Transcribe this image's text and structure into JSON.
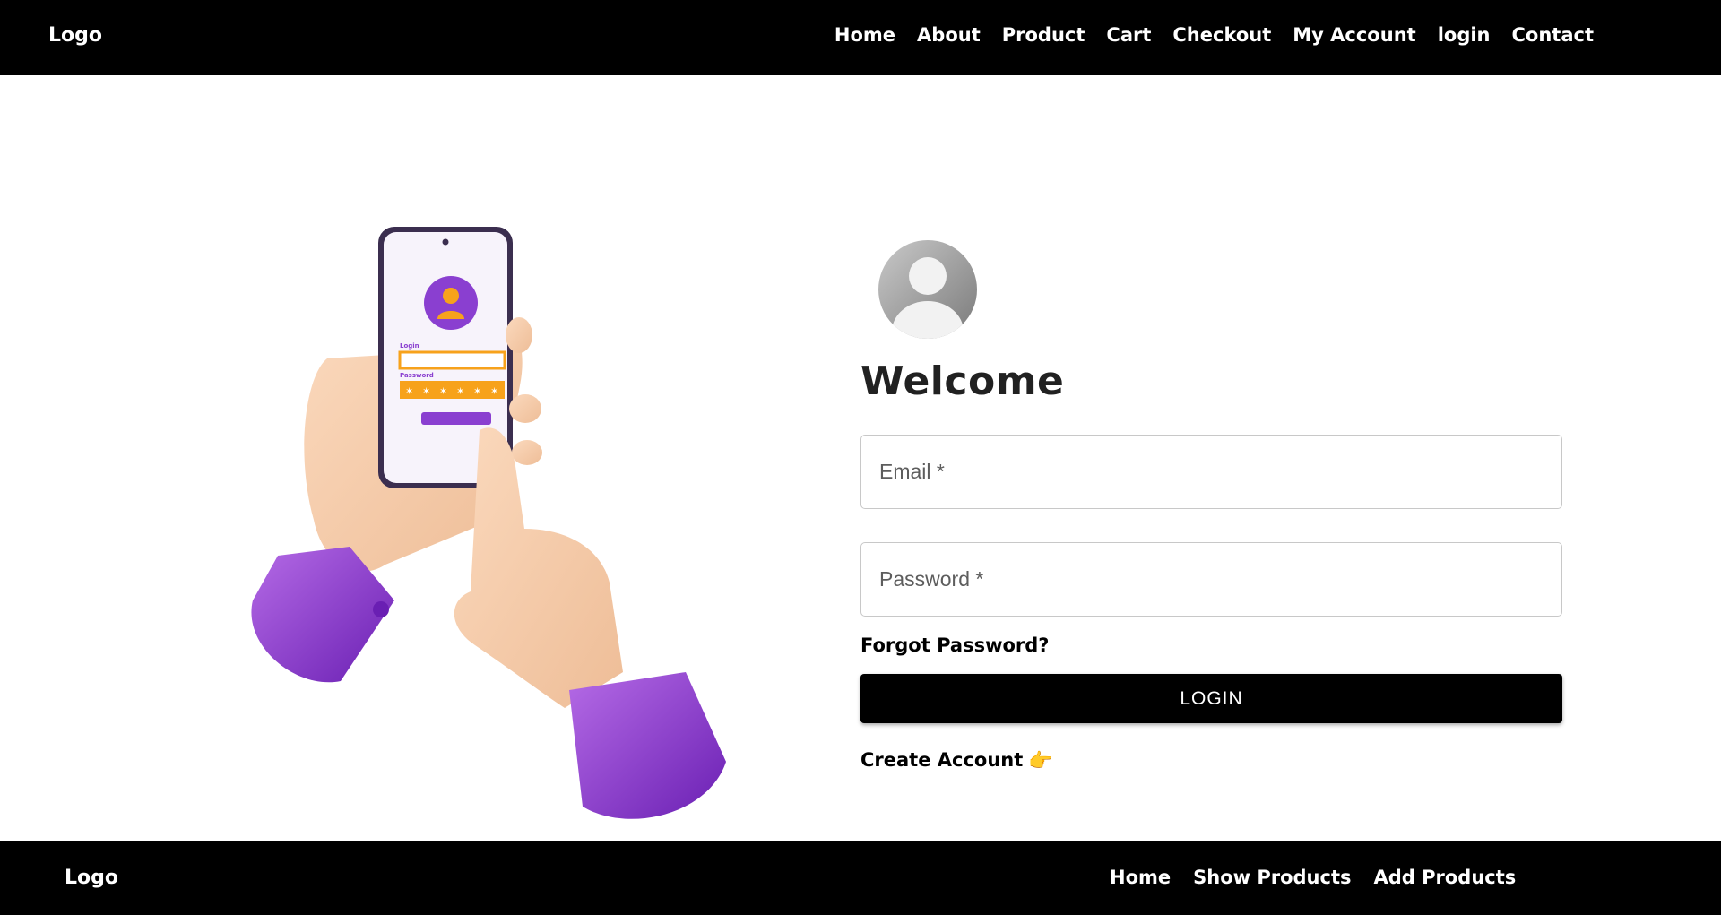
{
  "header": {
    "logo": "Logo",
    "nav": [
      "Home",
      "About",
      "Product",
      "Cart",
      "Checkout",
      "My Account",
      "login",
      "Contact"
    ]
  },
  "illustration": {
    "phone_login_label": "Login",
    "phone_password_label": "Password",
    "colors": {
      "purple": "#8a3fd0",
      "orange": "#f7a21b",
      "skin": "#f4c9a6"
    }
  },
  "form": {
    "title": "Welcome",
    "email_placeholder": "Email *",
    "password_placeholder": "Password *",
    "forgot_label": "Forgot Password?",
    "login_label": "LOGIN",
    "create_label": "Create Account",
    "create_icon": "pointing-hand-icon"
  },
  "footer": {
    "logo": "Logo",
    "nav": [
      "Home",
      "Show Products",
      "Add Products"
    ]
  }
}
